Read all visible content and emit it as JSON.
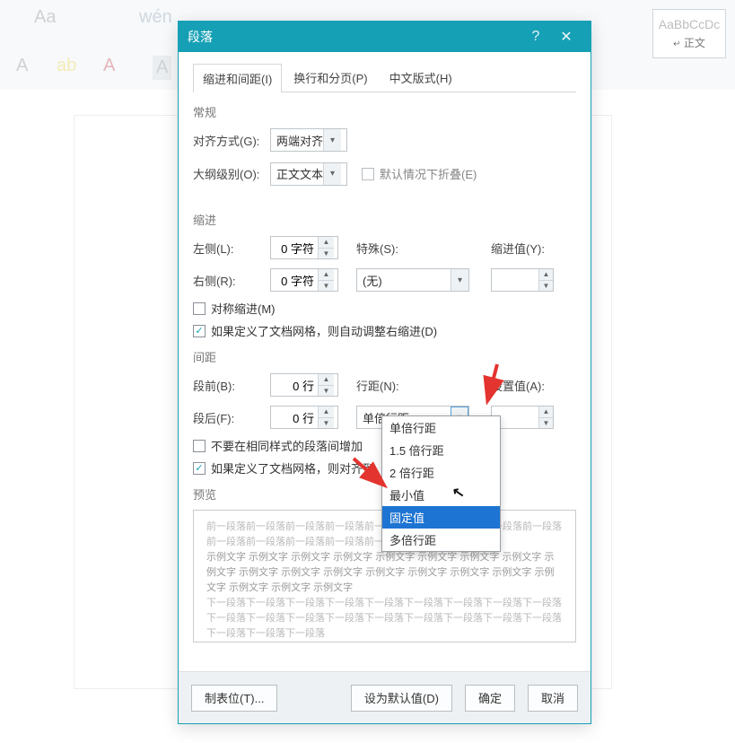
{
  "ribbon_style": {
    "sample": "AaBbCcDc",
    "name": "正文"
  },
  "dialog": {
    "title": "段落",
    "help_tooltip": "?",
    "tabs": {
      "t1": "缩进和间距(I)",
      "t2": "换行和分页(P)",
      "t3": "中文版式(H)"
    }
  },
  "general": {
    "heading": "常规",
    "align_label": "对齐方式(G):",
    "align_value": "两端对齐",
    "outline_label": "大纲级别(O):",
    "outline_value": "正文文本",
    "fold_label": "默认情况下折叠(E)"
  },
  "indent": {
    "heading": "缩进",
    "left_label": "左侧(L):",
    "left_value": "0 字符",
    "right_label": "右侧(R):",
    "right_value": "0 字符",
    "special_label": "特殊(S):",
    "special_value": "(无)",
    "by_label": "缩进值(Y):",
    "by_value": "",
    "mirror_label": "对称缩进(M)",
    "autogrid_label": "如果定义了文档网格，则自动调整右缩进(D)"
  },
  "spacing": {
    "heading": "间距",
    "before_label": "段前(B):",
    "before_value": "0 行",
    "after_label": "段后(F):",
    "after_value": "0 行",
    "line_label": "行距(N):",
    "line_value": "单倍行距",
    "at_label": "设置值(A):",
    "at_value": "",
    "nosame_label": "不要在相同样式的段落间增加",
    "snapgrid_label": "如果定义了文档网格，则对齐到"
  },
  "line_spacing_options": {
    "o1": "单倍行距",
    "o2": "1.5 倍行距",
    "o3": "2 倍行距",
    "o4": "最小值",
    "o5": "固定值",
    "o6": "多倍行距"
  },
  "preview": {
    "heading": "预览",
    "para_prev": "前一段落前一段落前一段落前一段落前一段落前一段落前一段落前一段落前一段落前一段落前一段落前一段落前一段落前一段落",
    "para_mid": "示例文字 示例文字 示例文字 示例文字 示例文字 示例文字 示例文字 示例文字 示例文字 示例文字 示例文字 示例文字 示例文字 示例文字 示例文字 示例文字 示例文字 示例文字 示例文字 示例文字",
    "para_next": "下一段落下一段落下一段落下一段落下一段落下一段落下一段落下一段落下一段落下一段落下一段落下一段落下一段落下一段落下一段落下一段落下一段落下一段落下一段落下一段落下一段落"
  },
  "footer": {
    "tabs_btn": "制表位(T)...",
    "default_btn": "设为默认值(D)",
    "ok_btn": "确定",
    "cancel_btn": "取消"
  }
}
